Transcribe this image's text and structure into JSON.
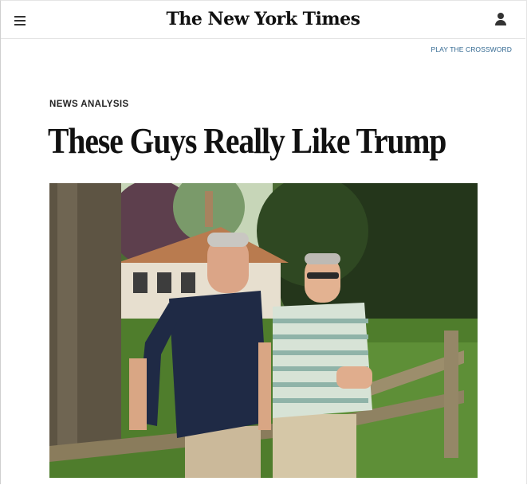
{
  "header": {
    "logo_text": "The New York Times",
    "menu_icon": "hamburger-menu-icon",
    "account_icon": "user-account-icon"
  },
  "links": {
    "crossword": "PLAY THE CROSSWORD"
  },
  "article": {
    "kicker": "NEWS ANALYSIS",
    "headline": "These Guys Really Like Trump"
  },
  "colors": {
    "link": "#326891",
    "text": "#111111"
  }
}
